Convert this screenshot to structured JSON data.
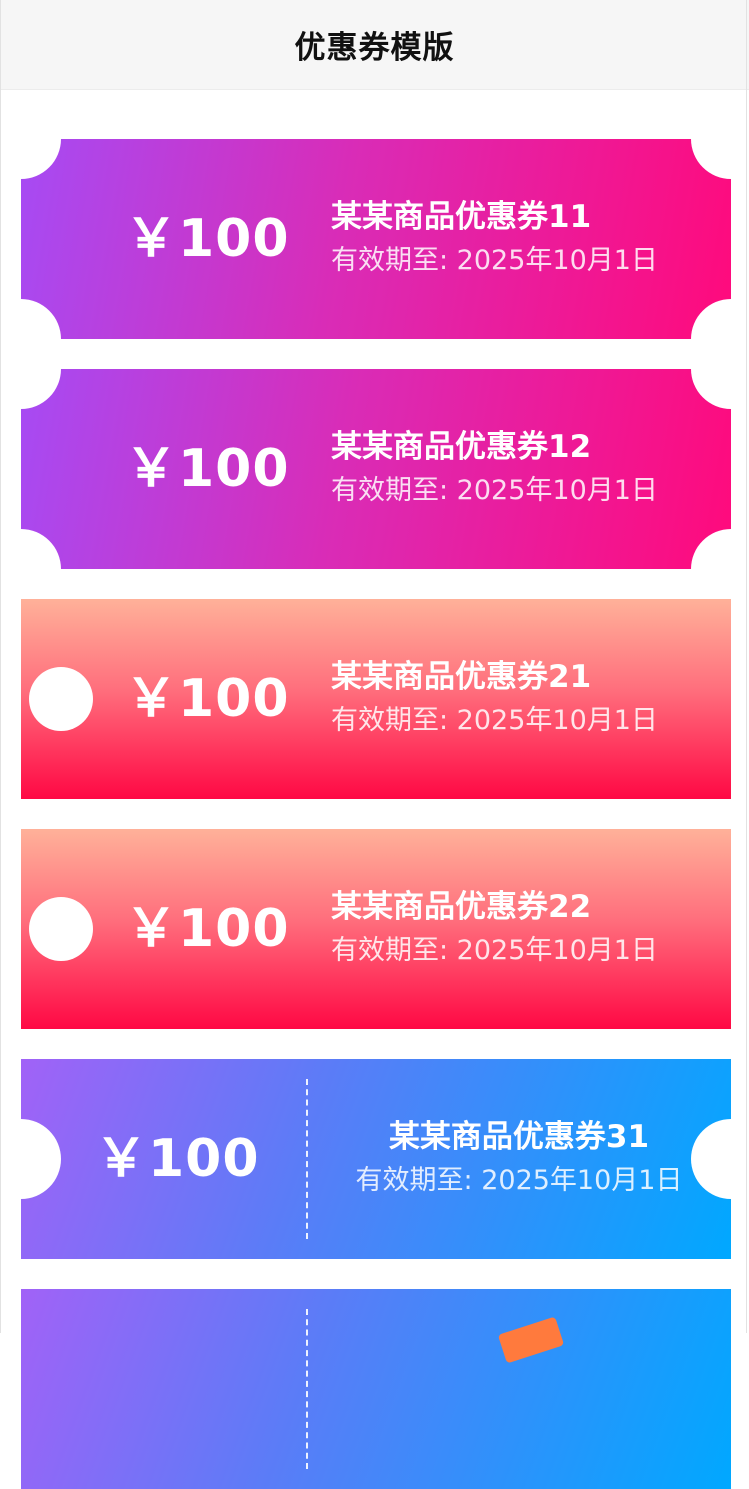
{
  "page": {
    "title": "优惠券模版"
  },
  "coupons": [
    {
      "amount": "￥100",
      "name": "某某商品优惠券11",
      "validity": "有效期至: 2025年10月1日"
    },
    {
      "amount": "￥100",
      "name": "某某商品优惠券12",
      "validity": "有效期至: 2025年10月1日"
    },
    {
      "amount": "￥100",
      "name": "某某商品优惠券21",
      "validity": "有效期至: 2025年10月1日"
    },
    {
      "amount": "￥100",
      "name": "某某商品优惠券22",
      "validity": "有效期至: 2025年10月1日"
    },
    {
      "amount": "￥100",
      "name": "某某商品优惠券31",
      "validity": "有效期至: 2025年10月1日"
    }
  ],
  "colors": {
    "style1": [
      "#a64bf4",
      "#ff0a7c"
    ],
    "style2": [
      "#ffb199",
      "#ff0844"
    ],
    "style3": [
      "#a162f7",
      "#00a8ff"
    ]
  }
}
